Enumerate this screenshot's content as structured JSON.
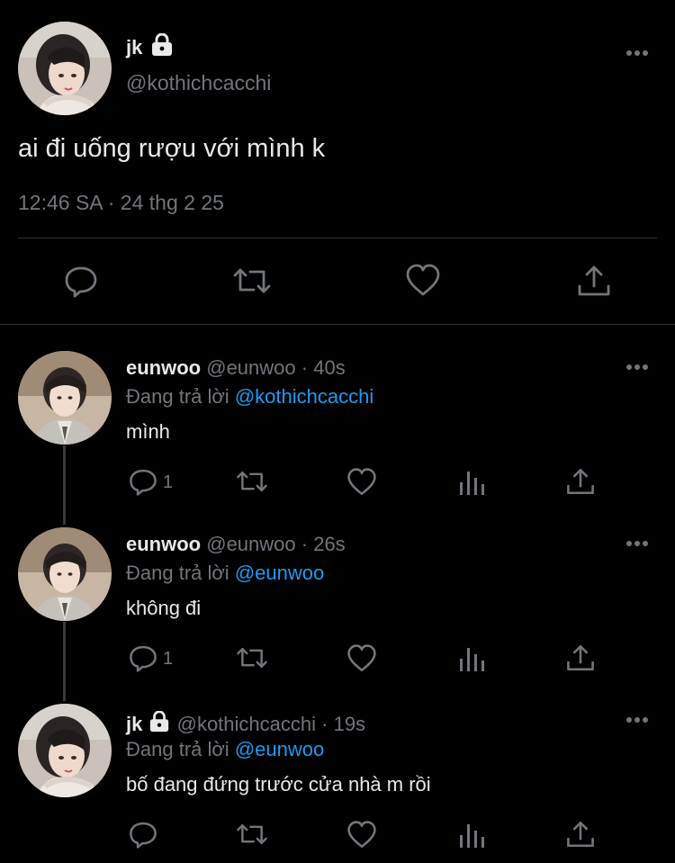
{
  "main_tweet": {
    "display_name": "jk",
    "handle": "@kothichcacchi",
    "text": "ai đi uống rượu với mình k",
    "timestamp": "12:46 SA · 24 thg 2 25",
    "locked": true
  },
  "replies": [
    {
      "display_name": "eunwoo",
      "handle": "@eunwoo",
      "time": "· 40s",
      "replying_prefix": "Đang trả lời",
      "replying_to": "@kothichcacchi",
      "text": "mình",
      "reply_count": "1",
      "locked": false
    },
    {
      "display_name": "eunwoo",
      "handle": "@eunwoo",
      "time": "· 26s",
      "replying_prefix": "Đang trả lời",
      "replying_to": "@eunwoo",
      "text": "không đi",
      "reply_count": "1",
      "locked": false
    },
    {
      "display_name": "jk",
      "handle": "@kothichcacchi",
      "time": "· 19s",
      "replying_prefix": "Đang trả lời",
      "replying_to": "@eunwoo",
      "text": "bố đang đứng trước cửa nhà m rồi",
      "reply_count": "",
      "locked": true
    }
  ],
  "icons": {
    "reply": "reply-icon",
    "retweet": "retweet-icon",
    "like": "like-icon",
    "views": "views-icon",
    "share": "share-icon",
    "more": "more-icon",
    "lock": "lock-icon"
  },
  "colors": {
    "background": "#000000",
    "text": "#e7e9ea",
    "muted": "#71767b",
    "link": "#1d9bf0",
    "divider": "#2f3336"
  }
}
